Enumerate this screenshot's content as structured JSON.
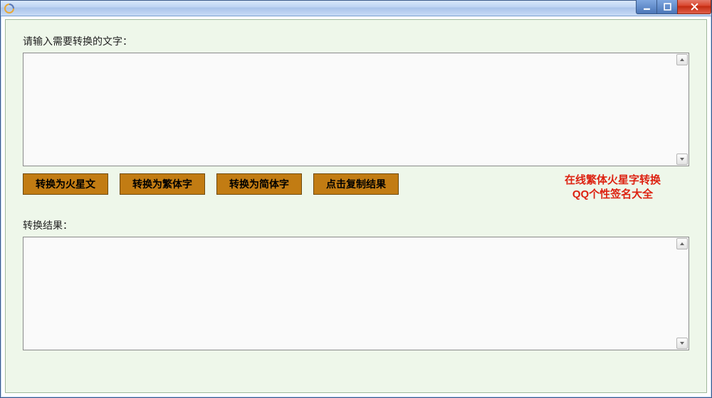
{
  "window": {
    "title": ""
  },
  "labels": {
    "input_prompt": "请输入需要转换的文字：",
    "result_prompt": "转换结果："
  },
  "inputs": {
    "source_text": "",
    "result_text": ""
  },
  "buttons": {
    "to_mars": "转换为火星文",
    "to_trad": "转换为繁体字",
    "to_simp": "转换为简体字",
    "copy_result": "点击复制结果"
  },
  "promo": {
    "line1": "在线繁体火星字转换",
    "line2": "QQ个性签名大全"
  }
}
